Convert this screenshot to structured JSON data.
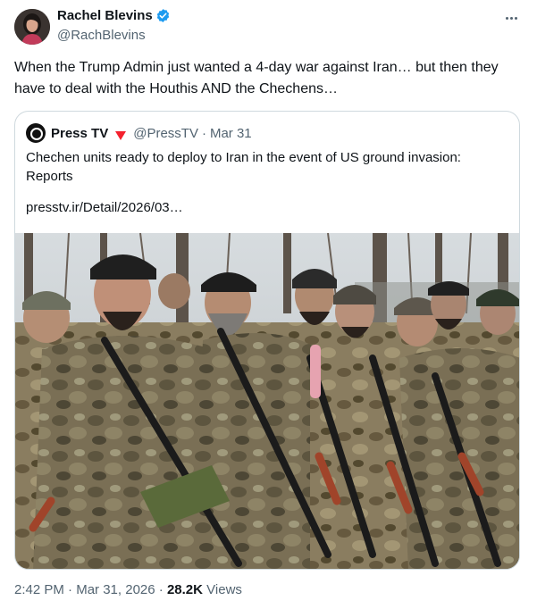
{
  "author": {
    "display_name": "Rachel Blevins",
    "handle": "@RachBlevins",
    "verified": true
  },
  "tweet": {
    "text": "When the Trump Admin just wanted a 4-day war against Iran… but then they have to deal with the Houthis AND the Chechens…"
  },
  "quoted_tweet": {
    "display_name": "Press TV",
    "handle": "@PressTV",
    "separator": "·",
    "date": "Mar 31",
    "text": "Chechen units ready to deploy to Iran in the event of US ground invasion: Reports",
    "link": "presstv.ir/Detail/2026/03…"
  },
  "meta": {
    "time": "2:42 PM",
    "separator": "·",
    "date": "Mar 31, 2026",
    "views_count": "28.2K",
    "views_label": "Views"
  },
  "colors": {
    "text": "#0f1419",
    "secondary": "#536471",
    "border": "#cfd9de",
    "verified": "#1d9bf0",
    "flag": "#f4212e"
  },
  "icons": {
    "verified": "verified-badge-icon",
    "more": "more-options-icon",
    "state_media": "state-affiliated-flag-icon"
  }
}
